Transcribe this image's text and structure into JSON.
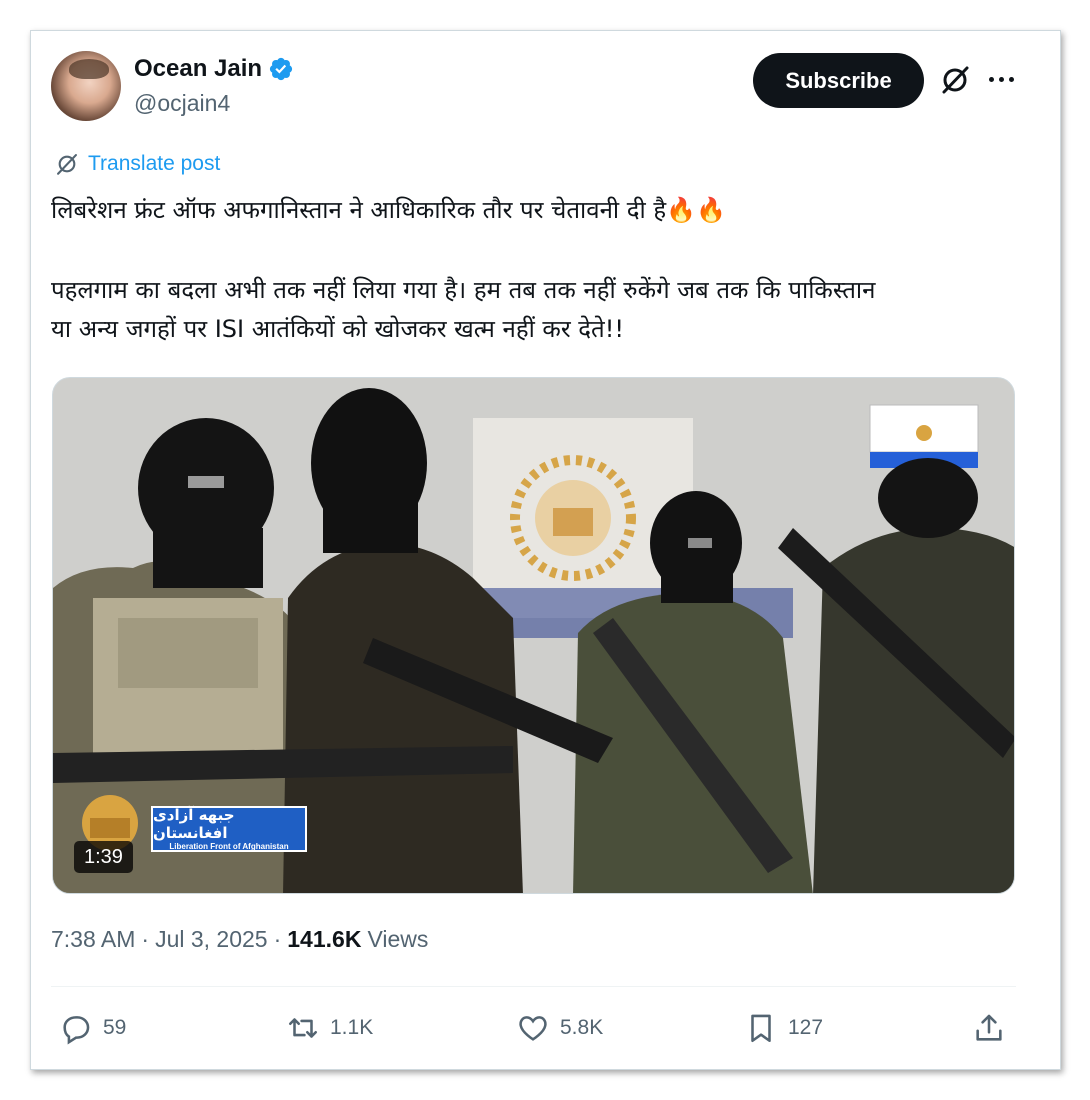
{
  "author": {
    "display_name": "Ocean Jain",
    "handle": "@ocjain4",
    "verified": true
  },
  "header": {
    "subscribe_label": "Subscribe",
    "grok_icon": "grok-icon",
    "more_icon": "more-icon"
  },
  "translate": {
    "label": "Translate post",
    "icon": "translate-icon"
  },
  "post": {
    "line1": "लिबरेशन फ्रंट ऑफ अफगानिस्तान ने आधिकारिक तौर पर चेतावनी दी है🔥🔥",
    "line2": "पहलगाम का बदला अभी तक नहीं लिया गया है। हम तब तक नहीं रुकेंगे जब तक कि पाकिस्तान",
    "line3": "या अन्य जगहों पर ISI आतंकियों को खोजकर खत्म नहीं कर देते!!"
  },
  "media": {
    "duration": "1:39",
    "badge_arabic": "جبهه آزادی افغانستان",
    "badge_english": "Liberation Front of Afghanistan"
  },
  "meta": {
    "time": "7:38 AM",
    "date": "Jul 3, 2025",
    "views_count": "141.6K",
    "views_label": "Views",
    "separator": "·"
  },
  "actions": {
    "replies": "59",
    "reposts": "1.1K",
    "likes": "5.8K",
    "bookmarks": "127"
  },
  "colors": {
    "accent": "#1d9bf0",
    "text_primary": "#0f1419",
    "text_secondary": "#536471",
    "subscribe_bg": "#0f1419"
  }
}
